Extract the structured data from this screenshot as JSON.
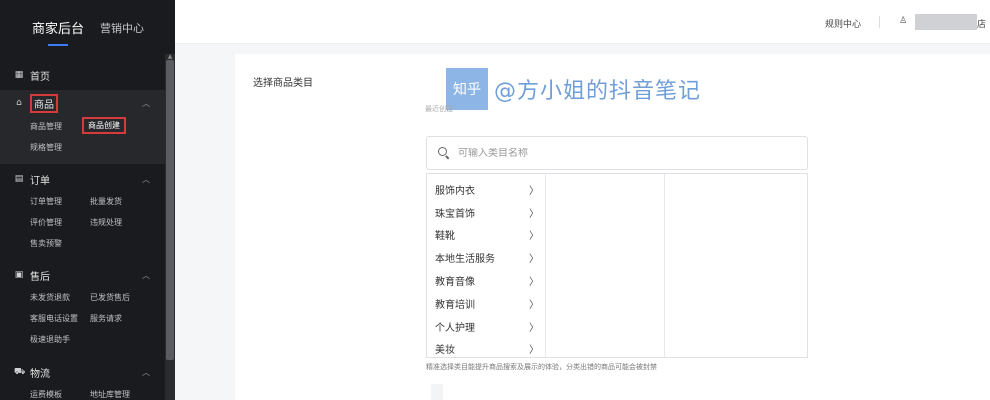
{
  "sidebar": {
    "brand": "商家后台",
    "marketing": "营销中心",
    "home": "首页",
    "goods": {
      "title": "商品",
      "items": [
        "商品管理",
        "商品创建",
        "规格管理"
      ]
    },
    "orders": {
      "title": "订单",
      "items": [
        "订单管理",
        "批量发货",
        "评价管理",
        "违规处理",
        "售卖预警"
      ]
    },
    "aftersale": {
      "title": "售后",
      "items": [
        "未发货退款",
        "已发货售后",
        "客服电话设置",
        "服务请求",
        "极速退助手"
      ]
    },
    "logistics": {
      "title": "物流",
      "items": [
        "运费模板",
        "地址库管理"
      ]
    }
  },
  "topbar": {
    "rules_center": "规则中心",
    "shop_suffix": "店"
  },
  "panel": {
    "title": "选择商品类目",
    "recent": "最近创建",
    "search_placeholder": "可输入类目名称",
    "categories": [
      "服饰内衣",
      "珠宝首饰",
      "鞋靴",
      "本地生活服务",
      "教育音像",
      "教育培训",
      "个人护理",
      "美妆"
    ],
    "hint": "精准选择类目能提升商品搜索及展示的体验，分类出错的商品可能会被封禁"
  },
  "watermark": {
    "logo": "知乎",
    "text": "@方小姐的抖音笔记"
  }
}
